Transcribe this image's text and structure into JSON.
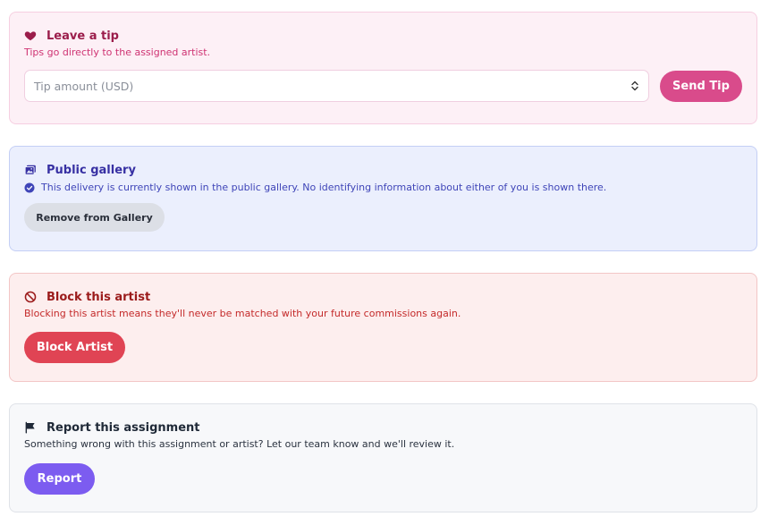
{
  "tip": {
    "title": "Leave a tip",
    "description": "Tips go directly to the assigned artist.",
    "amount_placeholder": "Tip amount (USD)",
    "send_label": "Send Tip",
    "icon": "heart-icon"
  },
  "gallery": {
    "title": "Public gallery",
    "status": "This delivery is currently shown in the public gallery. No identifying information about either of you is shown there.",
    "remove_label": "Remove from Gallery",
    "icon": "image-icon",
    "status_icon": "check-circle-icon"
  },
  "block": {
    "title": "Block this artist",
    "description": "Blocking this artist means they'll never be matched with your future commissions again.",
    "button_label": "Block Artist",
    "icon": "ban-icon"
  },
  "report": {
    "title": "Report this assignment",
    "description": "Something wrong with this assignment or artist? Let our team know and we'll review it.",
    "button_label": "Report",
    "icon": "flag-icon"
  },
  "colors": {
    "tip_accent": "#d94b8b",
    "gallery_accent": "#3730a3",
    "block_accent": "#e04454",
    "report_accent": "#7c5cf0"
  }
}
